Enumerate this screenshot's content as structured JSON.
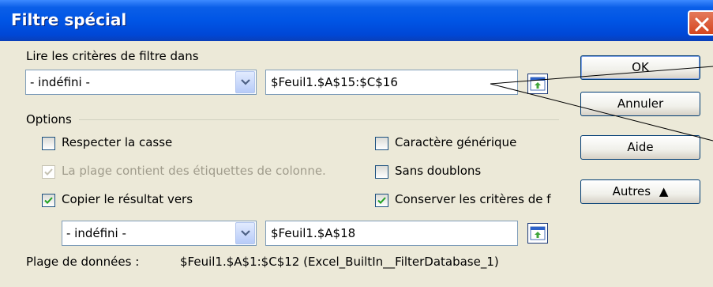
{
  "window": {
    "title": "Filtre spécial"
  },
  "criteria": {
    "label": "Lire les critères de filtre dans",
    "combo_value": "- indéfini -",
    "range_value": "$Feuil1.$A$15:$C$16"
  },
  "options": {
    "group_label": "Options",
    "respect_case": {
      "label": "Respecter la casse",
      "checked": false
    },
    "range_has_labels": {
      "label": "La plage contient des étiquettes de colonne.",
      "checked": true,
      "disabled": true
    },
    "copy_result": {
      "label": "Copier le résultat vers",
      "checked": true
    },
    "wildcard": {
      "label": "Caractère générique",
      "checked": false
    },
    "no_duplicates": {
      "label": "Sans doublons",
      "checked": false
    },
    "keep_criteria": {
      "label": "Conserver les critères de f",
      "checked": true
    },
    "output_combo_value": "- indéfini -",
    "output_range_value": "$Feuil1.$A$18"
  },
  "data_range": {
    "label": "Plage de données :",
    "value": "$Feuil1.$A$1:$C$12 (Excel_BuiltIn__FilterDatabase_1)"
  },
  "buttons": {
    "ok": "OK",
    "cancel": "Annuler",
    "help": "Aide",
    "more": "Autres"
  }
}
